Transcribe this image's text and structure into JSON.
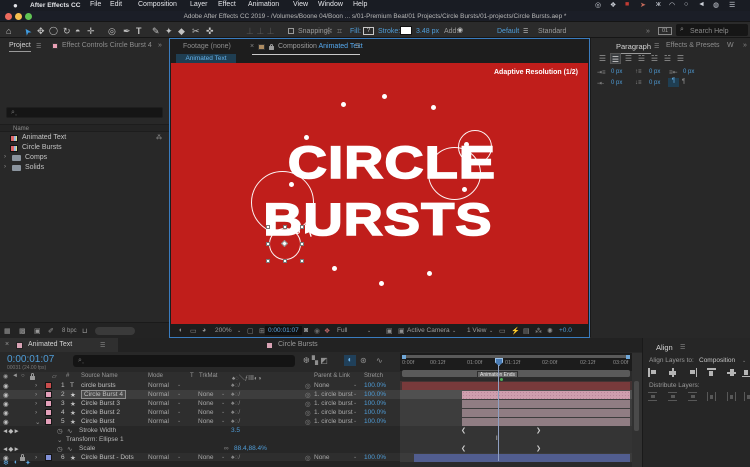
{
  "menu_bar": {
    "items": [
      "After Effects CC",
      "File",
      "Edit",
      "Composition",
      "Layer",
      "Effect",
      "Animation",
      "View",
      "Window",
      "Help"
    ],
    "status_icons": [
      {
        "name": "globe-icon",
        "glyph": "◎"
      },
      {
        "name": "cc-icon",
        "glyph": "❖"
      },
      {
        "name": "app-red-icon",
        "glyph": "■"
      },
      {
        "name": "rocket-icon",
        "glyph": "➤"
      },
      {
        "name": "bluetooth-icon",
        "glyph": "ж"
      },
      {
        "name": "wifi-icon",
        "glyph": "◠"
      },
      {
        "name": "spotlight-icon",
        "glyph": "○"
      },
      {
        "name": "volume-icon",
        "glyph": "◄"
      },
      {
        "name": "siri-icon",
        "glyph": "◍"
      },
      {
        "name": "list-icon",
        "glyph": "☰"
      }
    ]
  },
  "title_bar": {
    "title": "Adobe After Effects CC 2019 - /Volumes/Boone 04/Boon ... s/01-Premium Beat/01 Projects/Circle Bursts/01-projects/Circle Bursts.aep *"
  },
  "toolbar": {
    "tools": [
      {
        "name": "home-tool",
        "glyph": "⌂"
      },
      {
        "name": "selection-tool",
        "glyph": "➤"
      },
      {
        "name": "hand-tool",
        "glyph": "✥"
      },
      {
        "name": "zoom-tool",
        "glyph": "◯"
      },
      {
        "name": "orbit-tool",
        "glyph": "↻"
      },
      {
        "name": "camera-tool",
        "glyph": "◓"
      },
      {
        "name": "pan-tool",
        "glyph": "✛"
      },
      {
        "name": "shape-tool",
        "glyph": "◎"
      },
      {
        "name": "pen-tool",
        "glyph": "✒"
      },
      {
        "name": "type-tool",
        "glyph": "T"
      },
      {
        "name": "brush-tool",
        "glyph": "✎"
      },
      {
        "name": "stamp-tool",
        "glyph": "✦"
      },
      {
        "name": "eraser-tool",
        "glyph": "◆"
      },
      {
        "name": "rotobrush-tool",
        "glyph": "✂"
      },
      {
        "name": "puppet-tool",
        "glyph": "✜"
      }
    ],
    "snapping_label": "Snapping",
    "fill_label": "Fill:",
    "fill_value": "?",
    "stroke_label": "Stroke:",
    "stroke_width": "3.48 px",
    "add_label": "Add:",
    "workspace": "Default",
    "workspace_alt": "Standard",
    "search_placeholder": "Search Help"
  },
  "project_panel": {
    "tab_project": "Project",
    "tab_effects": "Effect Controls Circle Burst 4",
    "name_header": "Name",
    "items": [
      {
        "label": "Animated Text",
        "type": "comp"
      },
      {
        "label": "Circle Bursts",
        "type": "comp"
      },
      {
        "label": "Comps",
        "type": "folder"
      },
      {
        "label": "Solids",
        "type": "folder"
      }
    ],
    "footer_depth": "8 bpc"
  },
  "comp_panel": {
    "tab_footage": "Footage (none)",
    "tab_comp_prefix": "Composition",
    "tab_comp_name": "Animated Text",
    "viewer_button": "Animated Text",
    "adaptive_resolution": "Adaptive Resolution (1/2)",
    "canvas_line1": "CIRCLE",
    "canvas_line2": "BURSTS",
    "statusbar": {
      "zoom": "200%",
      "timecode": "0:00:01:07",
      "resolution": "Full",
      "camera": "Active Camera",
      "views": "1 View",
      "exposure": "+0.0"
    }
  },
  "paragraph_panel": {
    "tab_paragraph": "Paragraph",
    "tab_effects": "Effects & Presets",
    "tab_w": "W",
    "indent_values": [
      "0 px",
      "0 px",
      "0 px",
      "0 px",
      "0 px"
    ]
  },
  "align_panel": {
    "title": "Align",
    "align_to_label": "Align Layers to:",
    "align_to_value": "Composition",
    "distribute_label": "Distribute Layers:"
  },
  "timeline": {
    "tab1": "Animated Text",
    "tab2": "Circle Bursts",
    "timecode": "0:00:01:07",
    "frame_info": "00031 (24.00 fps)",
    "columns": {
      "num": "#",
      "source": "Source Name",
      "mode": "Mode",
      "t": "T",
      "trkmat": "TrkMat",
      "parent": "Parent & Link",
      "stretch": "Stretch"
    },
    "layers": [
      {
        "num": "1",
        "name": "circle bursts",
        "mode": "Normal",
        "parent": "None",
        "stretch": "100.0%"
      },
      {
        "num": "2",
        "name": "Circle Burst 4",
        "mode": "Normal",
        "trkmat": "None",
        "parent": "1. circle burst",
        "stretch": "100.0%"
      },
      {
        "num": "3",
        "name": "Circle Burst 3",
        "mode": "Normal",
        "trkmat": "None",
        "parent": "1. circle burst",
        "stretch": "100.0%"
      },
      {
        "num": "4",
        "name": "Circle Burst 2",
        "mode": "Normal",
        "trkmat": "None",
        "parent": "1. circle burst",
        "stretch": "100.0%"
      },
      {
        "num": "5",
        "name": "Circle Burst",
        "mode": "Normal",
        "trkmat": "None",
        "parent": "1. circle burst",
        "stretch": "100.0%"
      },
      {
        "num": "6",
        "name": "Circle Burst - Dots",
        "mode": "Normal",
        "trkmat": "None",
        "parent": "None",
        "stretch": "100.0%"
      }
    ],
    "properties": {
      "stroke_width_label": "Stroke Width",
      "stroke_width_value": "3.5",
      "transform_label": "Transform: Ellipse 1",
      "scale_label": "Scale",
      "scale_value": "88.4,88.4%"
    },
    "ruler": [
      "0:00f",
      "00:12f",
      "01:00f",
      "01:12f",
      "02:00f",
      "02:12f",
      "03:00f"
    ],
    "marker": "Animation Ends"
  },
  "colors": {
    "accent_blue": "#4f9dd8",
    "comp_red": "#c01e1b",
    "bar_red": "#783a3b",
    "bar_pink_selected": "#ce9eae",
    "bar_pink": "#907d83",
    "bar_blue": "#515d8f"
  }
}
